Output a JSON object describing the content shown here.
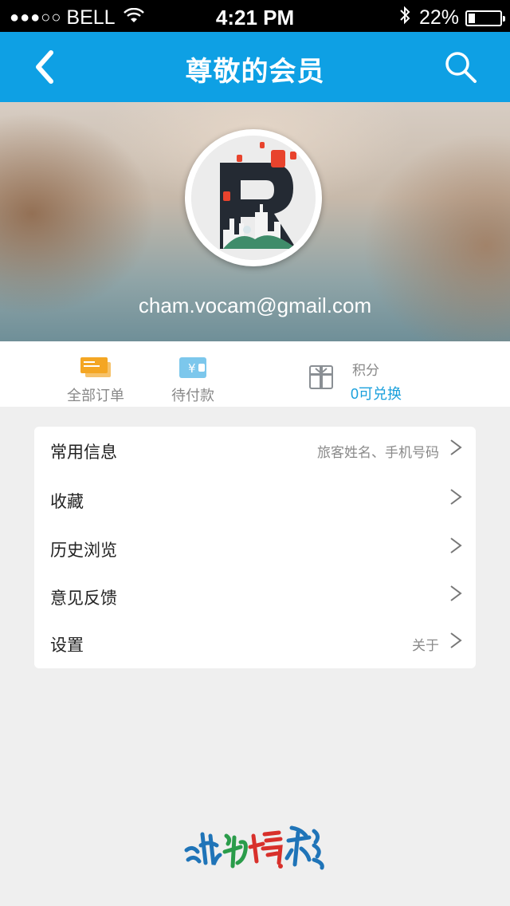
{
  "status_bar": {
    "signal": "●●●○○",
    "carrier": "BELL",
    "time": "4:21 PM",
    "battery": "22%",
    "battery_level": 0.22,
    "icons": [
      "wifi-icon",
      "bluetooth-icon",
      "battery-icon"
    ]
  },
  "nav": {
    "title": "尊敬的会员",
    "icons": [
      "back-icon",
      "search-icon"
    ]
  },
  "profile": {
    "email": "cham.vocam@gmail.com",
    "avatar_icon": "letter-r-city-avatar"
  },
  "stats": {
    "orders_label": "全部订单",
    "pending_label": "待付款",
    "points_label": "积分",
    "points_value": "0可兑换",
    "icons": [
      "ticket-icon",
      "wallet-yen-icon",
      "gift-icon"
    ]
  },
  "menu": [
    {
      "label": "常用信息",
      "hint": "旅客姓名、手机号码"
    },
    {
      "label": "收藏",
      "hint": ""
    },
    {
      "label": "历史浏览",
      "hint": ""
    },
    {
      "label": "意见反馈",
      "hint": ""
    },
    {
      "label": "设置",
      "hint": "关于"
    }
  ],
  "brand": {
    "logo_text": "游为精彩"
  },
  "colors": {
    "accent": "#0ea0e4",
    "points_blue": "#1aa0dc",
    "ticket_orange": "#f4a623",
    "background": "#efefef"
  }
}
